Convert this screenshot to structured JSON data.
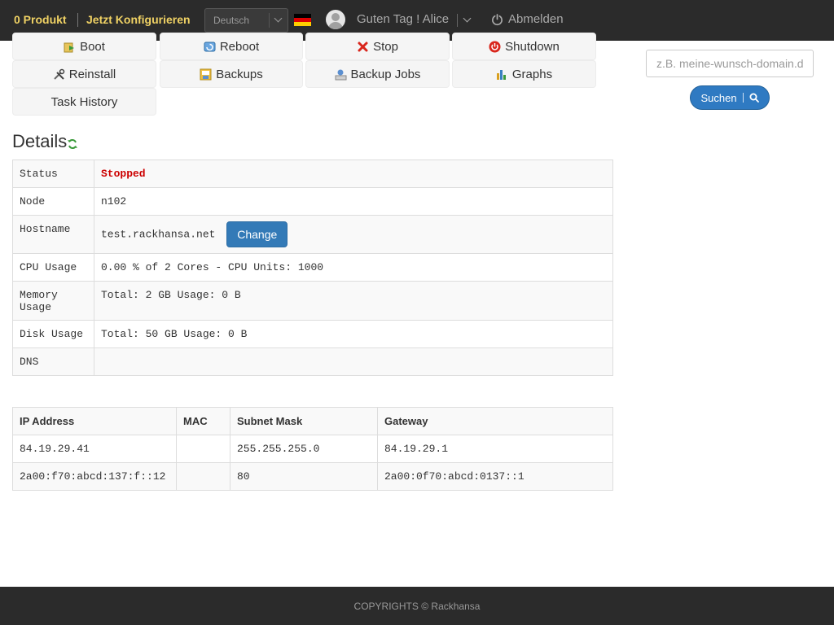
{
  "topbar": {
    "products": "0 Produkt",
    "configure": "Jetzt Konfigurieren",
    "language": "Deutsch",
    "greeting": "Guten Tag ! Alice",
    "logout": "Abmelden",
    "flag_icon": "germany-flag-icon"
  },
  "actions": [
    {
      "label": "Boot",
      "icon": "boot-icon"
    },
    {
      "label": "Reboot",
      "icon": "reboot-icon"
    },
    {
      "label": "Stop",
      "icon": "stop-icon"
    },
    {
      "label": "Shutdown",
      "icon": "shutdown-icon"
    },
    {
      "label": "Reinstall",
      "icon": "reinstall-icon"
    },
    {
      "label": "Backups",
      "icon": "backups-icon"
    },
    {
      "label": "Backup Jobs",
      "icon": "backup-jobs-icon"
    },
    {
      "label": "Graphs",
      "icon": "graphs-icon"
    },
    {
      "label": "Task History",
      "icon": ""
    }
  ],
  "domain_search": {
    "placeholder": "z.B. meine-wunsch-domain.de",
    "button": "Suchen"
  },
  "details": {
    "title": "Details",
    "rows": {
      "status": {
        "label": "Status",
        "value": "Stopped"
      },
      "node": {
        "label": "Node",
        "value": "n102"
      },
      "hostname": {
        "label": "Hostname",
        "value": "test.rackhansa.net",
        "button": "Change"
      },
      "cpu": {
        "label": "CPU Usage",
        "value": "0.00 % of 2 Cores - CPU Units: 1000"
      },
      "memory": {
        "label": "Memory Usage",
        "value": "Total: 2 GB Usage: 0 B"
      },
      "disk": {
        "label": "Disk Usage",
        "value": "Total: 50 GB Usage: 0 B"
      },
      "dns": {
        "label": "DNS",
        "value": ""
      }
    }
  },
  "ip_table": {
    "headers": [
      "IP Address",
      "MAC",
      "Subnet Mask",
      "Gateway"
    ],
    "rows": [
      [
        "84.19.29.41",
        "",
        "255.255.255.0",
        "84.19.29.1"
      ],
      [
        "2a00:f70:abcd:137:f::12",
        "",
        "80",
        "2a00:0f70:abcd:0137::1"
      ]
    ]
  },
  "footer": {
    "text": "COPYRIGHTS © Rackhansa"
  },
  "colors": {
    "topbar_bg": "#2b2b2b",
    "topbar_accent": "#f0d264",
    "primary": "#337ab7",
    "status_stopped": "#cc0000"
  }
}
